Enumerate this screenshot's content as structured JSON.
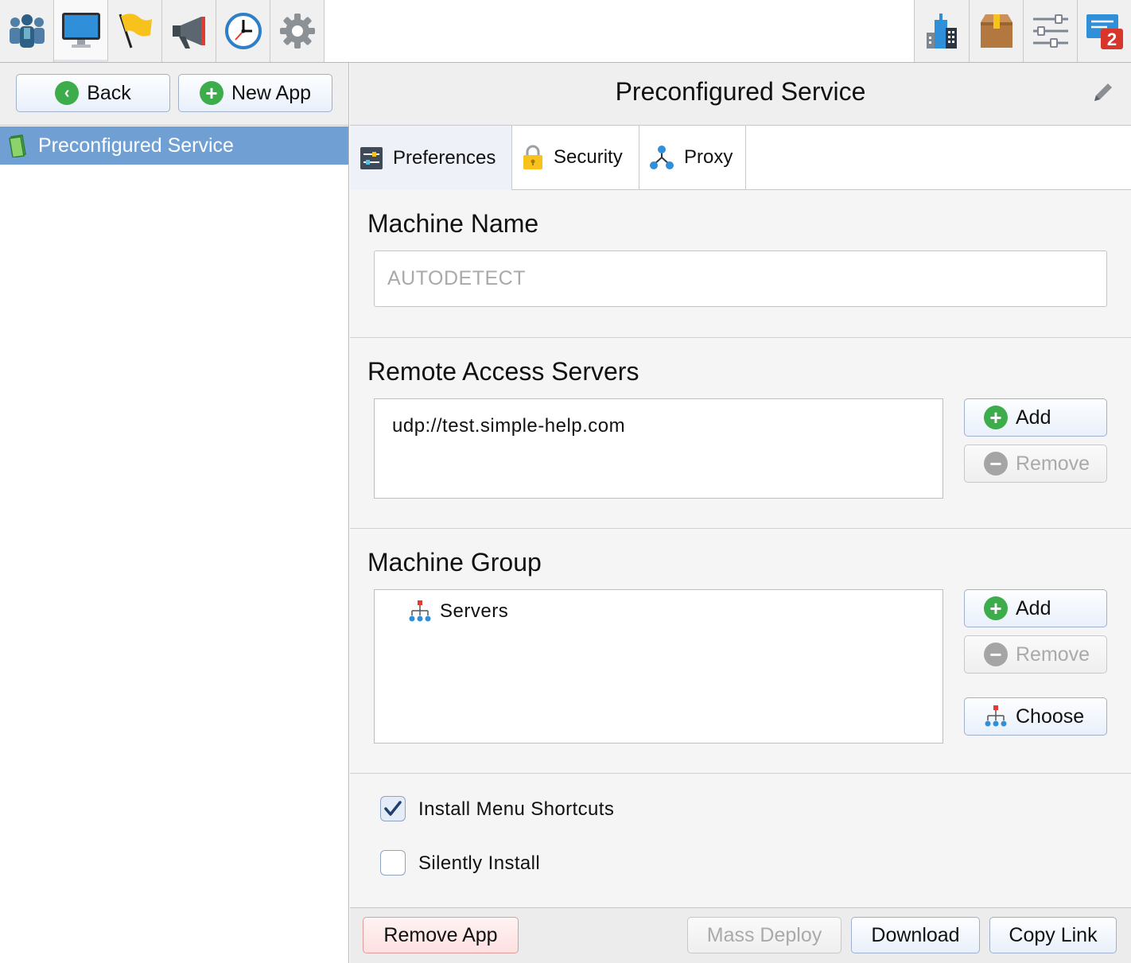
{
  "toolbar": {
    "left_icons": [
      "users-icon",
      "monitor-icon",
      "flag-icon",
      "megaphone-icon",
      "clock-icon",
      "gear-icon"
    ],
    "right_icons": [
      "buildings-icon",
      "package-icon",
      "sliders-icon",
      "messages-icon"
    ],
    "messages_badge": "2"
  },
  "left": {
    "back_label": "Back",
    "new_app_label": "New App",
    "tree_item": "Preconfigured Service"
  },
  "right": {
    "title": "Preconfigured Service",
    "tabs": [
      {
        "label": "Preferences",
        "icon": "preferences-icon"
      },
      {
        "label": "Security",
        "icon": "lock-icon"
      },
      {
        "label": "Proxy",
        "icon": "proxy-icon"
      }
    ],
    "machine_name": {
      "title": "Machine Name",
      "placeholder": "AUTODETECT"
    },
    "remote_access": {
      "title": "Remote Access Servers",
      "items": [
        "udp://test.simple-help.com"
      ],
      "add_label": "Add",
      "remove_label": "Remove"
    },
    "machine_group": {
      "title": "Machine Group",
      "items": [
        "Servers"
      ],
      "add_label": "Add",
      "remove_label": "Remove",
      "choose_label": "Choose"
    },
    "options": {
      "install_shortcuts": {
        "label": "Install Menu Shortcuts",
        "checked": true
      },
      "silently_install": {
        "label": "Silently Install",
        "checked": false
      }
    },
    "bottom": {
      "remove_app": "Remove App",
      "mass_deploy": "Mass Deploy",
      "download": "Download",
      "copy_link": "Copy Link"
    }
  },
  "colors": {
    "selection": "#6f9fd3",
    "accent_green": "#3dac4b",
    "badge_red": "#d9362b"
  }
}
